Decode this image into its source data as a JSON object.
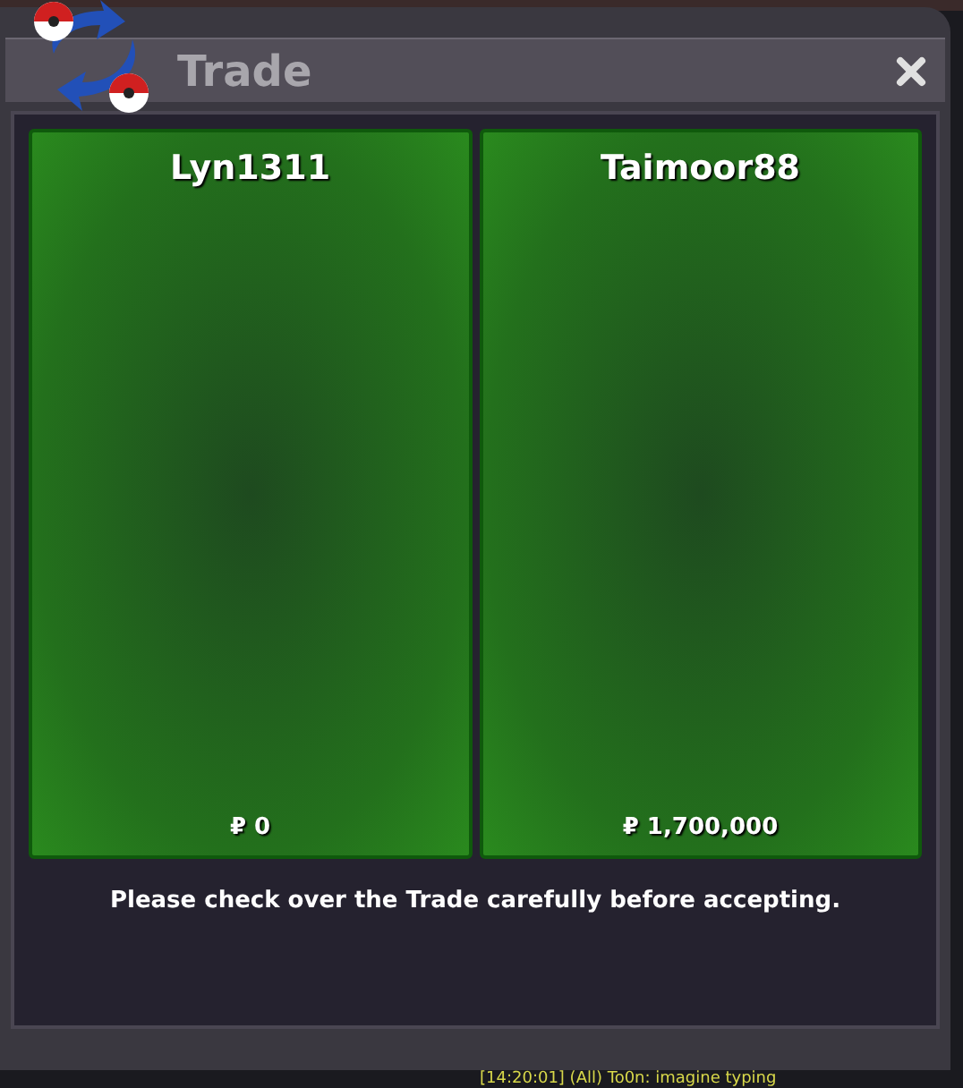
{
  "window": {
    "title": "Trade"
  },
  "offers": [
    {
      "name": "Lyn1311",
      "money": "₽ 0"
    },
    {
      "name": "Taimoor88",
      "money": "₽ 1,700,000"
    }
  ],
  "notice": "Please check over the Trade carefully before accepting.",
  "chat_line": "[14:20:01] (All) To0n: imagine typing"
}
